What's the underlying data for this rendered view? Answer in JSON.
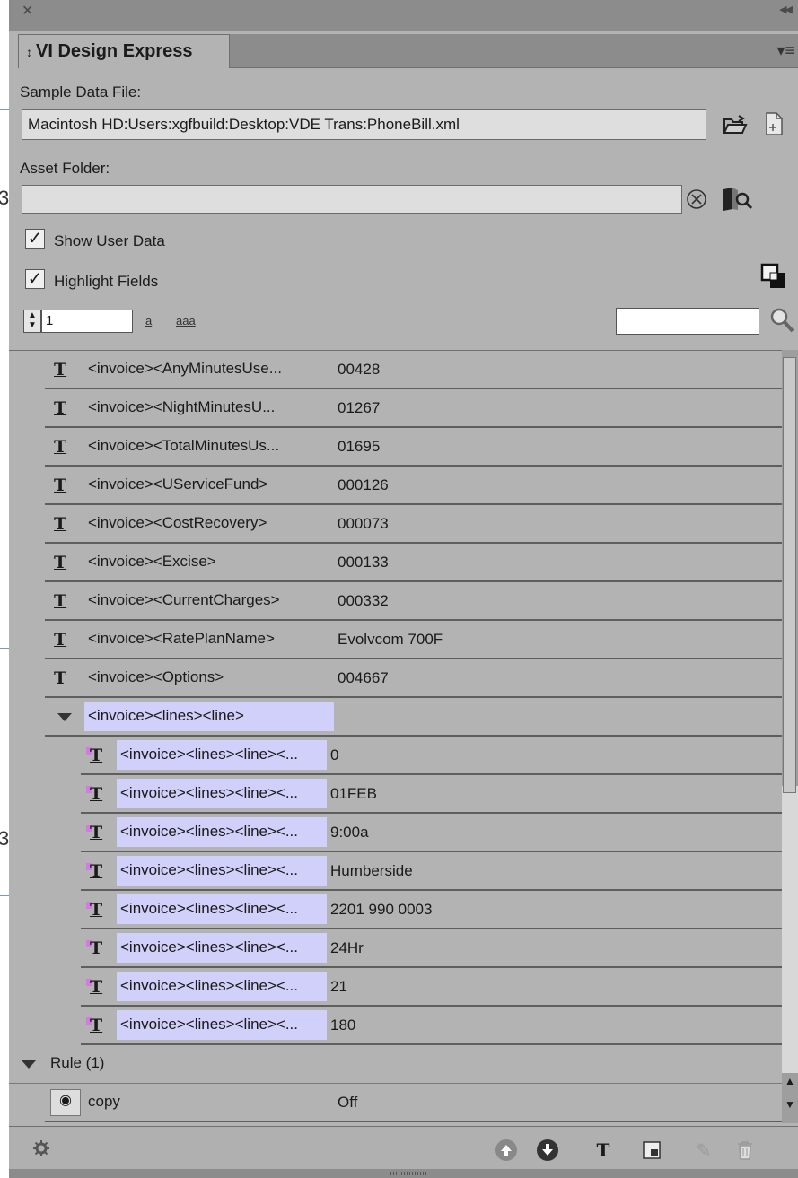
{
  "panel": {
    "title": "VI Design Express",
    "title_prefix": "↕"
  },
  "sample_data_file": {
    "label": "Sample Data File:",
    "value": "Macintosh HD:Users:xgfbuild:Desktop:VDE Trans:PhoneBill.xml"
  },
  "asset_folder": {
    "label": "Asset Folder:",
    "value": ""
  },
  "options": {
    "show_user_data": "Show User Data",
    "highlight_fields": "Highlight Fields"
  },
  "record": {
    "value": "1",
    "case_lower": "a",
    "case_mixed": "aaa"
  },
  "search": {
    "value": ""
  },
  "fields": [
    {
      "key": "<invoice><AnyMinutesUse...",
      "value": "00428"
    },
    {
      "key": "<invoice><NightMinutesU...",
      "value": "01267"
    },
    {
      "key": "<invoice><TotalMinutesUs...",
      "value": "01695"
    },
    {
      "key": "<invoice><UServiceFund>",
      "value": "000126"
    },
    {
      "key": "<invoice><CostRecovery>",
      "value": "000073"
    },
    {
      "key": "<invoice><Excise>",
      "value": "000133"
    },
    {
      "key": "<invoice><CurrentCharges>",
      "value": "000332"
    },
    {
      "key": "<invoice><RatePlanName>",
      "value": "Evolvcom 700F"
    },
    {
      "key": "<invoice><Options>",
      "value": "004667"
    }
  ],
  "group": {
    "label": "<invoice><lines><line>",
    "children": [
      {
        "key": "<invoice><lines><line><...",
        "value": "0"
      },
      {
        "key": "<invoice><lines><line><...",
        "value": "01FEB"
      },
      {
        "key": "<invoice><lines><line><...",
        "value": "9:00a"
      },
      {
        "key": "<invoice><lines><line><...",
        "value": "Humberside"
      },
      {
        "key": "<invoice><lines><line><...",
        "value": "2201 990 0003"
      },
      {
        "key": "<invoice><lines><line><...",
        "value": "24Hr"
      },
      {
        "key": "<invoice><lines><line><...",
        "value": "21"
      },
      {
        "key": "<invoice><lines><line><...",
        "value": "180"
      }
    ]
  },
  "rules": {
    "label": "Rule (1)",
    "items": [
      {
        "name": "copy",
        "state": "Off"
      }
    ]
  },
  "background_digits": [
    "3",
    "3"
  ],
  "icons": {
    "close": "close-icon",
    "collapse": "double-chevron-icon",
    "menu": "panel-menu-icon",
    "open_folder": "open-folder-icon",
    "new_file": "new-file-icon",
    "clear": "clear-circle-x-icon",
    "browse_assets": "browse-asset-icon",
    "highlight_toggle": "overlap-squares-icon",
    "search": "magnifier-icon",
    "settings": "gear-icon",
    "move_up": "arrow-up-circle-icon",
    "move_down": "arrow-down-circle-icon",
    "insert_field": "insert-text-field-icon",
    "insert_graphic": "insert-graphic-icon",
    "edit": "edit-pencil-icon",
    "delete": "trash-icon"
  },
  "colors": {
    "panel_bg": "#b3b3b3",
    "highlight": "#d1d0fa",
    "marker": "#d27be3"
  }
}
